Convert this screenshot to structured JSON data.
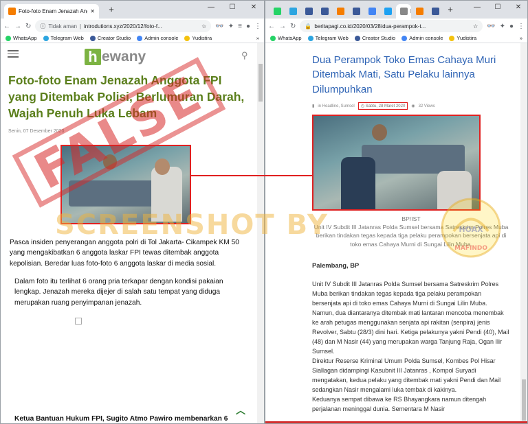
{
  "left": {
    "tab_title": "Foto-foto Enam Jenazah Anggota",
    "address_prefix": "Tidak aman",
    "address_url": "introdutions.xyz/2020/12/foto-f...",
    "site_logo_text": "ewany",
    "headline": "Foto-foto Enam Jenazah Anggota FPI yang Ditembak Polisi, Berlumuran Darah, Wajah Penuh Luka Lebam",
    "date": "Senin, 07 Desember 2020",
    "stamp_text": "FALSE",
    "para1": "Pasca insiden penyerangan anggota polri di Tol Jakarta- Cikampek KM 50 yang mengakibatkan 6 anggota laskar FPI tewas ditembak anggota kepolisian. Beredar luas foto-foto 6 anggota laskar di media sosial.",
    "para2": "Dalam foto itu terlihat 6 orang pria terkapar dengan kondisi pakaian lengkap. Jenazah mereka dijejer di salah satu tempat yang diduga merupakan ruang penyimpanan jenazah.",
    "para3": "Ketua Bantuan Hukum FPI, Sugito Atmo Pawiro membenarkan 6 anggota"
  },
  "right": {
    "tabs": [
      {
        "icon": "whatsapp-icon",
        "color": "#25d366"
      },
      {
        "icon": "telegram-icon",
        "color": "#2ca5e0"
      },
      {
        "icon": "facebook-icon",
        "color": "#3b5998"
      },
      {
        "icon": "facebook-icon",
        "color": "#3b5998"
      },
      {
        "icon": "blogger-icon",
        "color": "#f57d00"
      },
      {
        "icon": "facebook-icon",
        "color": "#3b5998"
      },
      {
        "icon": "google-icon",
        "color": "#4285f4"
      },
      {
        "icon": "twitter-icon",
        "color": "#1da1f2"
      },
      {
        "icon": "active-tab-icon",
        "color": "#888888"
      },
      {
        "icon": "blogger-icon",
        "color": "#f57d00"
      },
      {
        "icon": "facebook-icon",
        "color": "#3b5998"
      }
    ],
    "active_tab_label": "D",
    "address_url": "beritapagi.co.id/2020/03/28/dua-perampok-t...",
    "headline": "Dua Perampok Toko Emas Cahaya Muri Ditembak Mati, Satu Pelaku lainnya Dilumpuhkan",
    "category": "in Headline, Sumsel",
    "date": "Sabtu, 28 Maret 2020",
    "views": "32 Views",
    "caption_line1": "BP/IST",
    "caption_body": "Unit IV Subdit III Jatanras Polda Sumsel bersama Satreskrim Polres Muba berikan tindakan tegas kepada tiga pelaku perampokan bersenjata api di toko emas Cahaya Murni di Sungai Lilin Muba.",
    "dateline": "Palembang, BP",
    "body": "Unit IV Subdit III Jatanras Polda Sumsel bersama Satreskrim Polres Muba berikan tindakan tegas kepada tiga pelaku perampokan bersenjata api di toko emas Cahaya Murni di Sungai Lilin Muba.\nNamun, dua diantaranya ditembak mati lantaran mencoba menembak ke arah petugas menggunakan senjata api rakitan (senpira) jenis Revolver, Sabtu (28/3) dini hari. Ketiga pelakunya yakni Pendi (40), Mail (48) dan M Nasir (44) yang merupakan warga Tanjung Raja, Ogan Ilir Sumsel.\nDirektur Reserse Kriminal Umum Polda Sumsel, Kombes Pol Hisar Siallagan didampingi Kasubnit III Jatanras , Kompol Suryadi mengatakan, kedua pelaku yang ditembak mati yakni Pendi dan Mail sedangkan Nasir mengalami luka tembak di kakinya.\nKeduanya sempat dibawa ke RS Bhayangkara namun ditengah perjalanan meninggal dunia. Sementara M Nasir"
  },
  "bookmarks": [
    {
      "label": "WhatsApp",
      "icon": "whatsapp-icon",
      "color": "#25d366"
    },
    {
      "label": "Telegram Web",
      "icon": "telegram-icon",
      "color": "#2ca5e0"
    },
    {
      "label": "Creator Studio",
      "icon": "facebook-icon",
      "color": "#3b5998"
    },
    {
      "label": "Admin console",
      "icon": "google-icon",
      "color": "#4285f4"
    },
    {
      "label": "Yudistira",
      "icon": "yudistira-icon",
      "color": "#f4c20d"
    }
  ],
  "watermark": "SCREENSHOT BY",
  "mafindo_top": "MASYARAKAT ANTIFITNAH INDONESIA",
  "mafindo_name": "MAFINDO",
  "mafindo_hoax": "HOAX"
}
